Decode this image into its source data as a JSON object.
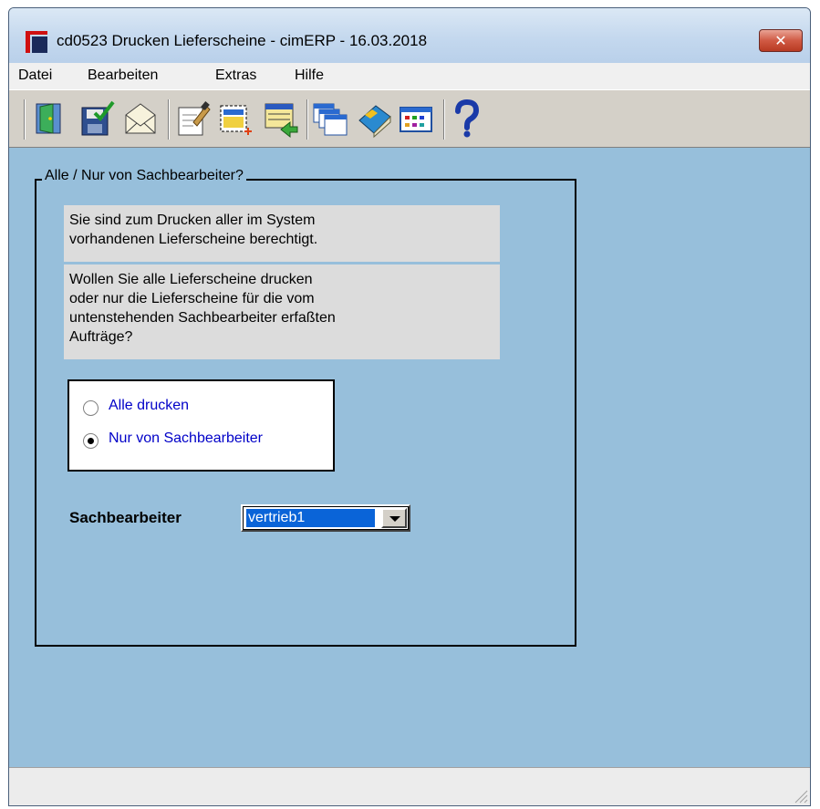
{
  "window": {
    "title": "cd0523 Drucken Lieferscheine - cimERP - 16.03.2018",
    "close_label": "✕"
  },
  "menu": [
    "Datei",
    "Bearbeiten",
    "Extras",
    "Hilfe"
  ],
  "toolbar": {
    "buttons": [
      "exit-door-icon",
      "save-check-icon",
      "mail-envelope-icon",
      "edit-document-icon",
      "new-record-icon",
      "list-transfer-icon",
      "windows-icon",
      "book-icon",
      "grid-table-icon",
      "help-question-icon"
    ]
  },
  "group": {
    "title": "Alle / Nur von Sachbearbeiter?",
    "message1_line1": "Sie sind zum Drucken aller im System",
    "message1_line2": "vorhandenen Lieferscheine berechtigt.",
    "message2_line1": "Wollen Sie alle Lieferscheine drucken",
    "message2_line2": "oder nur die Lieferscheine für die vom",
    "message2_line3": "untenstehenden Sachbearbeiter erfaßten",
    "message2_line4": "Aufträge?"
  },
  "options": {
    "all_label": "Alle drucken",
    "only_label": "Nur von Sachbearbeiter",
    "selected": "Nur von Sachbearbeiter"
  },
  "sachbearbeiter": {
    "label": "Sachbearbeiter",
    "value": "vertrieb1"
  },
  "colors": {
    "client_bg": "#97bfdb",
    "link_blue": "#0000c8",
    "selection": "#0a64d8"
  }
}
